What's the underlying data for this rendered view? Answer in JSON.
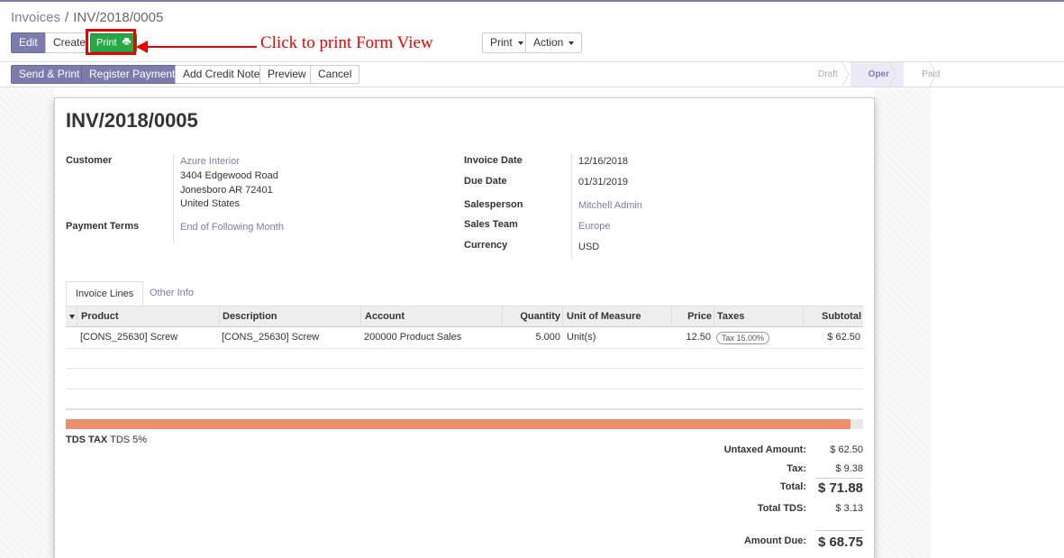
{
  "breadcrumb": {
    "parent": "Invoices",
    "separator": "/",
    "current": "INV/2018/0005"
  },
  "control": {
    "edit_label": "Edit",
    "create_label": "Create",
    "print_label": "Print",
    "print_dropdown_label": "Print",
    "action_dropdown_label": "Action"
  },
  "annotation": {
    "text": "Click to print Form View"
  },
  "header_buttons": {
    "send_print": "Send & Print",
    "register_payment": "Register Payment",
    "add_credit_note": "Add Credit Note",
    "preview": "Preview",
    "cancel": "Cancel"
  },
  "statusbar": {
    "steps": [
      "Draft",
      "Open",
      "Paid"
    ],
    "active": "Open"
  },
  "invoice": {
    "title": "INV/2018/0005",
    "customer_label": "Customer",
    "customer_name": "Azure Interior",
    "customer_address": [
      "3404 Edgewood Road",
      "Jonesboro AR 72401",
      "United States"
    ],
    "payment_terms_label": "Payment Terms",
    "payment_terms": "End of Following Month",
    "invoice_date_label": "Invoice Date",
    "invoice_date": "12/16/2018",
    "due_date_label": "Due Date",
    "due_date": "01/31/2019",
    "salesperson_label": "Salesperson",
    "salesperson": "Mitchell Admin",
    "sales_team_label": "Sales Team",
    "sales_team": "Europe",
    "currency_label": "Currency",
    "currency": "USD"
  },
  "tabs": {
    "lines": "Invoice Lines",
    "other": "Other Info"
  },
  "lines_table": {
    "columns": [
      "Product",
      "Description",
      "Account",
      "Quantity",
      "Unit of Measure",
      "Price",
      "Taxes",
      "Subtotal"
    ],
    "rows": [
      {
        "product": "[CONS_25630] Screw",
        "description": "[CONS_25630] Screw",
        "account": "200000 Product Sales",
        "quantity": "5.000",
        "uom": "Unit(s)",
        "price": "12.50",
        "tax": "Tax 15.00%",
        "subtotal": "$ 62.50"
      }
    ]
  },
  "tds": {
    "label": "TDS TAX",
    "value": "TDS 5%",
    "bar_fill_fraction": 0.984,
    "bar_color": "#ee8f6c"
  },
  "totals": {
    "untaxed_label": "Untaxed Amount:",
    "untaxed": "$ 62.50",
    "tax_label": "Tax:",
    "tax": "$ 9.38",
    "total_label": "Total:",
    "total": "$ 71.88",
    "total_tds_label": "Total TDS:",
    "total_tds": "$ 3.13",
    "amount_due_label": "Amount Due:",
    "amount_due": "$ 68.75"
  },
  "colors": {
    "brand": "#7c7bad",
    "success": "#28a745",
    "annotation": "#ee0000"
  }
}
